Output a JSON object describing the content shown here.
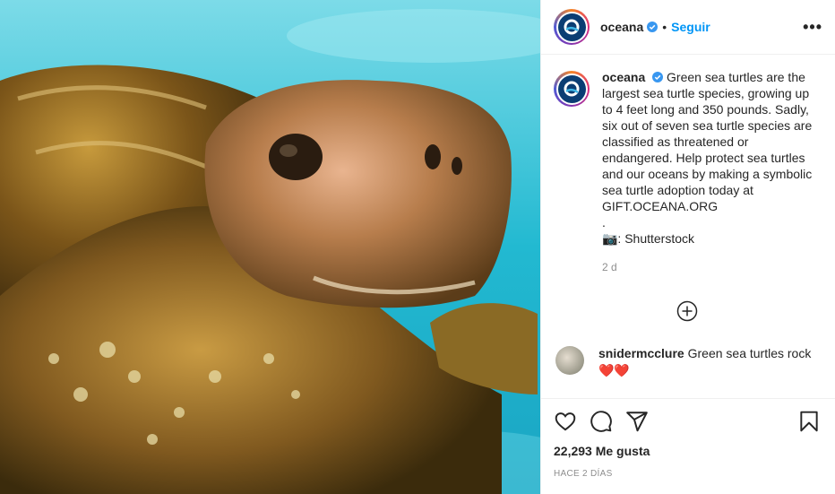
{
  "post": {
    "image_alt": "Green sea turtle swimming underwater",
    "header": {
      "username": "oceana",
      "separator": "•",
      "follow_label": "Seguir",
      "more_label": "•••"
    },
    "caption": {
      "username": "oceana",
      "lines": [
        "Green sea turtles are the",
        "largest sea turtle species, growing up",
        "to 4 feet long and 350 pounds. Sadly,",
        "six out of seven sea turtle species are",
        "classified as threatened or",
        "endangered. Help protect sea turtles",
        "and our oceans by making a symbolic",
        "sea turtle adoption today at",
        "GIFT.OCEANA.ORG",
        ".",
        "📷: Shutterstock"
      ],
      "age": "2 d"
    },
    "comments": [
      {
        "username": "snidermcclure",
        "text": "Green sea turtles rock",
        "emoji": "❤️❤️"
      }
    ],
    "likes": "22,293 Me gusta",
    "timestamp": "HACE 2 DÍAS"
  },
  "colors": {
    "accent": "#0095f6",
    "brand": "#0b3d73",
    "muted": "#8e8e8e",
    "heart_red": "#ed4956"
  }
}
